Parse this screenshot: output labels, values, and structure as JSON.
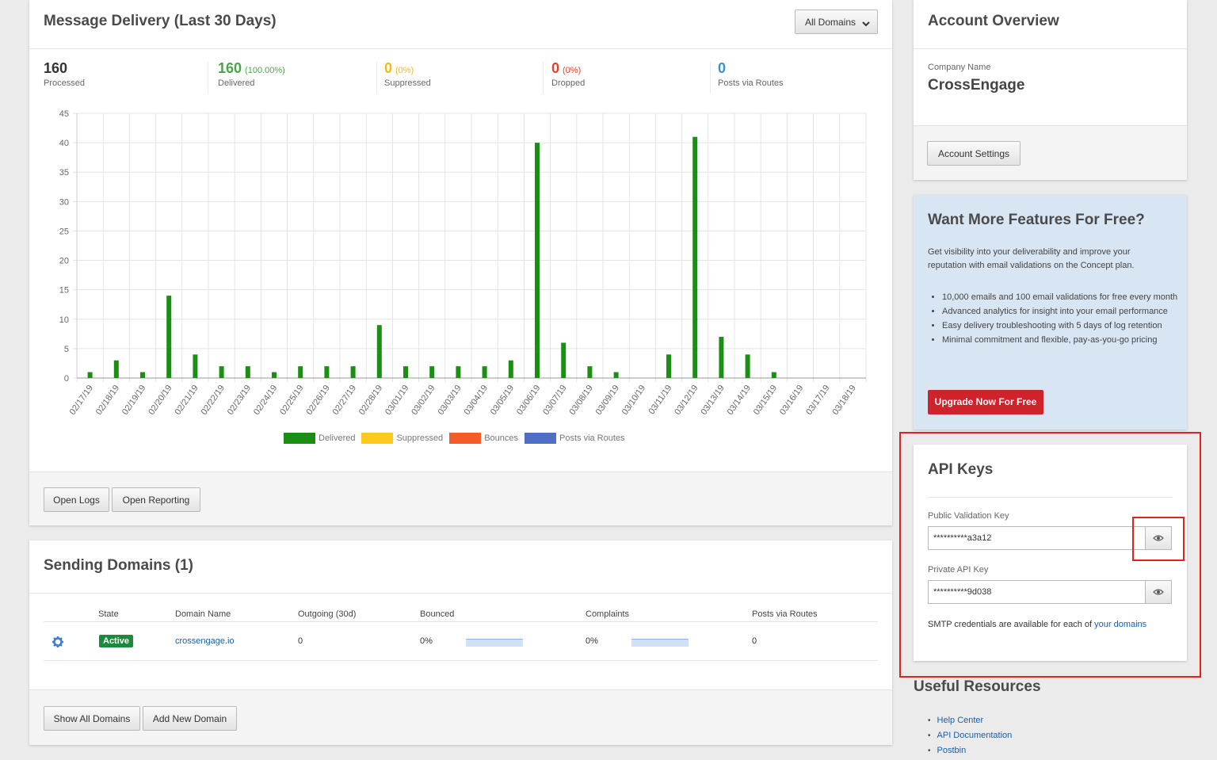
{
  "delivery": {
    "title": "Message Delivery (Last 30 Days)",
    "domain_select": "All Domains",
    "stats": [
      {
        "num": "160",
        "pct": "",
        "label": "Processed",
        "color": "#333333"
      },
      {
        "num": "160",
        "pct": "(100.00%)",
        "label": "Delivered",
        "color": "#4aa544"
      },
      {
        "num": "0",
        "pct": "(0%)",
        "label": "Suppressed",
        "color": "#f2b90f"
      },
      {
        "num": "0",
        "pct": "(0%)",
        "label": "Dropped",
        "color": "#e8402a"
      },
      {
        "num": "0",
        "pct": "",
        "label": "Posts via Routes",
        "color": "#3b8fd4"
      }
    ],
    "legend": [
      {
        "label": "Delivered",
        "color": "#1a8f13"
      },
      {
        "label": "Suppressed",
        "color": "#ffc81f"
      },
      {
        "label": "Bounces",
        "color": "#f45a2a"
      },
      {
        "label": "Posts via Routes",
        "color": "#4f6fc4"
      }
    ],
    "buttons": {
      "open_logs": "Open Logs",
      "open_reporting": "Open Reporting"
    }
  },
  "chart_data": {
    "type": "bar",
    "categories": [
      "02/17/19",
      "02/18/19",
      "02/19/19",
      "02/20/19",
      "02/21/19",
      "02/22/19",
      "02/23/19",
      "02/24/19",
      "02/25/19",
      "02/26/19",
      "02/27/19",
      "02/28/19",
      "03/01/19",
      "03/02/19",
      "03/03/19",
      "03/04/19",
      "03/05/19",
      "03/06/19",
      "03/07/19",
      "03/08/19",
      "03/09/19",
      "03/10/19",
      "03/11/19",
      "03/12/19",
      "03/13/19",
      "03/14/19",
      "03/15/19",
      "03/16/19",
      "03/17/19",
      "03/18/19"
    ],
    "series": [
      {
        "name": "Delivered",
        "values": [
          1,
          3,
          1,
          14,
          4,
          2,
          2,
          1,
          2,
          2,
          2,
          9,
          2,
          2,
          2,
          2,
          3,
          40,
          6,
          2,
          1,
          0,
          4,
          41,
          7,
          4,
          1,
          0,
          0,
          0
        ]
      },
      {
        "name": "Suppressed",
        "values": [
          0,
          0,
          0,
          0,
          0,
          0,
          0,
          0,
          0,
          0,
          0,
          0,
          0,
          0,
          0,
          0,
          0,
          0,
          0,
          0,
          0,
          0,
          0,
          0,
          0,
          0,
          0,
          0,
          0,
          0
        ]
      },
      {
        "name": "Bounces",
        "values": [
          0,
          0,
          0,
          0,
          0,
          0,
          0,
          0,
          0,
          0,
          0,
          0,
          0,
          0,
          0,
          0,
          0,
          0,
          0,
          0,
          0,
          0,
          0,
          0,
          0,
          0,
          0,
          0,
          0,
          0
        ]
      },
      {
        "name": "Posts via Routes",
        "values": [
          0,
          0,
          0,
          0,
          0,
          0,
          0,
          0,
          0,
          0,
          0,
          0,
          0,
          0,
          0,
          0,
          0,
          0,
          0,
          0,
          0,
          0,
          0,
          0,
          0,
          0,
          0,
          0,
          0,
          0
        ]
      }
    ],
    "yticks": [
      "0",
      "5",
      "10",
      "15",
      "20",
      "25",
      "30",
      "35",
      "40",
      "45"
    ],
    "ylim": [
      0,
      45
    ],
    "grid": true,
    "legend_position": "bottom"
  },
  "domains": {
    "title": "Sending Domains (1)",
    "headers": [
      "State",
      "Domain Name",
      "Outgoing (30d)",
      "Bounced",
      "Complaints",
      "Posts via Routes"
    ],
    "row": {
      "state": "Active",
      "domain": "crossengage.io",
      "outgoing": "0",
      "bounced": "0%",
      "complaints": "0%",
      "posts": "0"
    },
    "buttons": {
      "show_all": "Show All Domains",
      "add_new": "Add New Domain"
    }
  },
  "account": {
    "title": "Account Overview",
    "company_label": "Company Name",
    "company_name": "CrossEngage",
    "settings_button": "Account Settings"
  },
  "promo": {
    "title": "Want More Features For Free?",
    "text": "Get visibility into your deliverability and improve your reputation with email validations on the Concept plan.",
    "bullets": [
      "10,000 emails and 100 email validations for free every month",
      "Advanced analytics for insight into your email performance",
      "Easy delivery troubleshooting with 5 days of log retention",
      "Minimal commitment and flexible, pay-as-you-go pricing"
    ],
    "button": "Upgrade Now For Free"
  },
  "api": {
    "title": "API Keys",
    "public_label": "Public Validation Key",
    "public_value": "**********a3a12",
    "private_label": "Private API Key",
    "private_value": "**********9d038",
    "smtp_text": "SMTP credentials are available for each of",
    "smtp_link": "your domains"
  },
  "resources": {
    "title": "Useful Resources",
    "links": [
      "Help Center",
      "API Documentation",
      "Postbin"
    ]
  },
  "icons": [
    "chevron-down-icon",
    "gear-icon",
    "eye-icon"
  ],
  "colors": {
    "accent_red": "#d0222a",
    "promo_bg": "#d8e6f4",
    "highlight": "#e0211c"
  }
}
